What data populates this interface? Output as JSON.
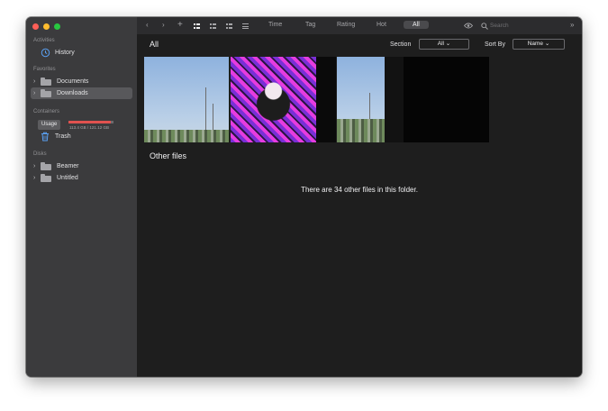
{
  "sidebar": {
    "activities": {
      "heading": "Activities",
      "items": [
        {
          "label": "History",
          "icon": "history-icon"
        }
      ]
    },
    "favorites": {
      "heading": "Favorites",
      "items": [
        {
          "label": "Documents",
          "icon": "folder-icon"
        },
        {
          "label": "Downloads",
          "icon": "folder-icon",
          "selected": true
        }
      ]
    },
    "containers": {
      "heading": "Containers",
      "usage_label": "Usage",
      "usage_text": "113.4 GB / 121.12 GB",
      "usage_fraction": 0.936,
      "items": [
        {
          "label": "Trash",
          "icon": "trash-icon"
        }
      ]
    },
    "disks": {
      "heading": "Disks",
      "items": [
        {
          "label": "Beamer",
          "icon": "folder-icon"
        },
        {
          "label": "Untitled",
          "icon": "folder-icon"
        }
      ]
    }
  },
  "toolbar": {
    "tabs": [
      "Time",
      "Tag",
      "Rating",
      "Hot",
      "All"
    ],
    "active_tab": "All",
    "search_placeholder": "Search",
    "icons": [
      "back-icon",
      "forward-icon",
      "add-icon",
      "grid-large-icon",
      "grid-small-icon",
      "grid-icon",
      "list-icon",
      "eye-icon",
      "search-icon",
      "expand-icon"
    ]
  },
  "main": {
    "title": "All",
    "section_label": "Section",
    "section_value": "All",
    "sort_label": "Sort By",
    "sort_value": "Name",
    "other_files_title": "Other files",
    "other_files_message": "There are 34 other files in this folder."
  },
  "colors": {
    "sidebar_bg": "#3b3b3d",
    "main_bg": "#1e1e1e",
    "toolbar_bg": "#2c2c2e",
    "usage_bar": "#e0524f"
  }
}
